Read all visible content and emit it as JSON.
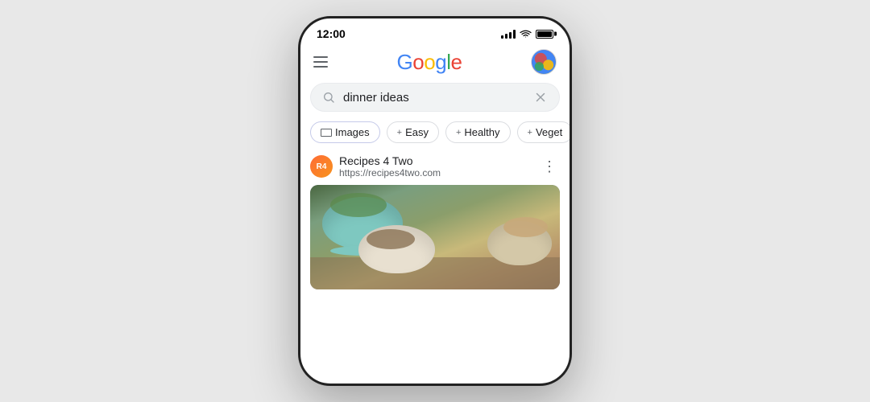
{
  "phone": {
    "status_bar": {
      "time": "12:00",
      "signal_label": "signal",
      "wifi_label": "wifi",
      "battery_label": "battery"
    },
    "header": {
      "menu_label": "menu",
      "logo": {
        "g1": "G",
        "g2": "o",
        "g3": "o",
        "g4": "g",
        "g5": "l",
        "g6": "e",
        "full": "Google"
      },
      "avatar_label": "user avatar"
    },
    "search": {
      "query": "dinner ideas",
      "placeholder": "Search",
      "clear_label": "clear search"
    },
    "chips": [
      {
        "id": "images",
        "label": "Images",
        "type": "images"
      },
      {
        "id": "easy",
        "label": "Easy",
        "type": "plus"
      },
      {
        "id": "healthy",
        "label": "Healthy",
        "type": "plus"
      },
      {
        "id": "veget",
        "label": "Veget",
        "type": "plus"
      }
    ],
    "result": {
      "site_name": "Recipes 4 Two",
      "site_url": "https://recipes4two.com",
      "favicon_text": "R4",
      "more_icon": "⋮"
    }
  }
}
